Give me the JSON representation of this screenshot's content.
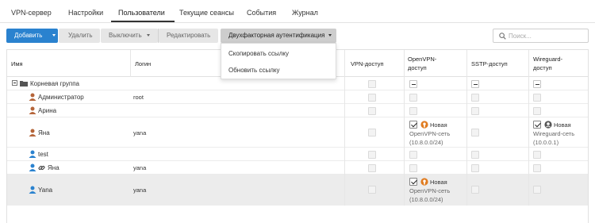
{
  "tabs": [
    "VPN-сервер",
    "Настройки",
    "Пользователи",
    "Текущие сеансы",
    "События",
    "Журнал"
  ],
  "toolbar": {
    "add": "Добавить",
    "delete": "Удалить",
    "disable": "Выключить",
    "edit": "Редактировать",
    "twofactor": "Двухфакторная аутентификация"
  },
  "search": {
    "placeholder": "Поиск..."
  },
  "dropdown": {
    "copy_link": "Скопировать ссылку",
    "refresh_link": "Обновить ссылку"
  },
  "columns": {
    "name": "Имя",
    "login": "Логин",
    "vpn": "VPN-доступ",
    "openvpn_1": "OpenVPN-",
    "openvpn_2": "доступ",
    "sstp": "SSTP-доступ",
    "wireguard_1": "Wireguard-",
    "wireguard_2": "доступ"
  },
  "rows": [
    {
      "name": "Корневая группа",
      "login": ""
    },
    {
      "name": "Администратор",
      "login": "root"
    },
    {
      "name": "Арина",
      "login": ""
    },
    {
      "name": "Яна",
      "login": "yana",
      "openvpn": {
        "title": "Новая",
        "net": "OpenVPN-сеть",
        "addr": "(10.8.0.0/24)"
      },
      "wireguard": {
        "title": "Новая",
        "net": "Wireguard-сеть",
        "addr": "(10.0.0.1)"
      }
    },
    {
      "name": "test",
      "login": ""
    },
    {
      "name": "Яна",
      "login": "yana"
    },
    {
      "name": "Yana",
      "login": "yana",
      "openvpn": {
        "title": "Новая",
        "net": "OpenVPN-сеть",
        "addr": "(10.8.0.0/24)"
      }
    }
  ],
  "colors": {
    "primary": "#2a82cf",
    "user_orange": "#b5653a",
    "user_blue": "#2a82cf",
    "selected_row": "#ececec"
  },
  "icons": [
    "search-icon",
    "expand-tree-icon",
    "folder-icon",
    "user-icon",
    "link-icon",
    "openvpn-icon",
    "wireguard-icon"
  ]
}
